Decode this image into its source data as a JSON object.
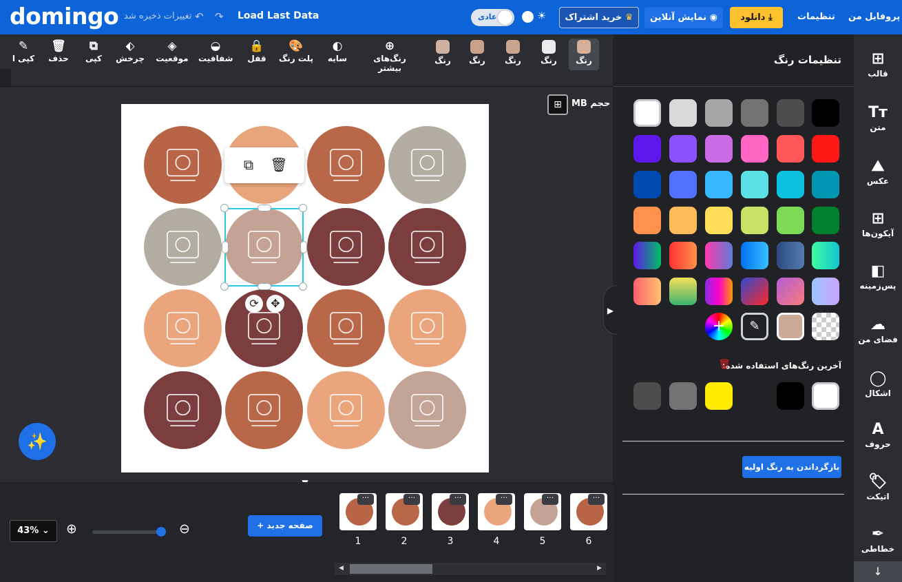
{
  "topbar": {
    "logo": "domingo",
    "save_status": "تغییرات ذخیره شد",
    "undo_icon": "↶",
    "redo_icon": "↷",
    "load_last": "Load Last Data",
    "mode_toggle": "عادی",
    "sun_icon": "☀",
    "subscribe": "خرید اشتراک",
    "crown_icon": "♛",
    "online_preview": "نمایش آنلاین",
    "eye_icon": "◉",
    "download": "دانلود",
    "download_icon": "⤓",
    "settings": "تنظیمات",
    "profile": "پروفایل من"
  },
  "toolbar": {
    "copy_style": "کپی ا",
    "delete": "حذف",
    "copy": "کپی",
    "rotate": "چرخش",
    "position": "موقعیت",
    "opacity": "شفافیت",
    "lock": "قفل",
    "palette": "پلت رنگ",
    "shadow": "سایه",
    "more_colors": "رنگ‌های بیشتر",
    "color_label": "رنگ",
    "color_swatches": [
      "#d4b09a",
      "#ededed",
      "#c9a590",
      "#ececec",
      "#c9a18a",
      "#cdb0a0"
    ]
  },
  "canvas": {
    "size_label": "حجم MB",
    "circle_colors": [
      "#b76546",
      "#e8a47b",
      "#b86848",
      "#b3ada1",
      "#b3ada1",
      "#c5a394",
      "#7b3d3d",
      "#7b3d3d",
      "#eba57c",
      "#7b3d3d",
      "#b86848",
      "#eba57c",
      "#7b3d3d",
      "#b86848",
      "#eba57c",
      "#c2a596"
    ],
    "ctx_copy_icon": "⧉",
    "ctx_delete_icon": "🗑",
    "rotate_icon": "⟳",
    "move_icon": "✥"
  },
  "bottom": {
    "zoom": "43% ⌄",
    "zoom_in_icon": "⊕",
    "zoom_out_icon": "⊖",
    "new_page": "+ صفحه جدید",
    "pages": [
      {
        "num": "1",
        "color": "#b76546"
      },
      {
        "num": "2",
        "color": "#b86848"
      },
      {
        "num": "3",
        "color": "#7b3d3d"
      },
      {
        "num": "4",
        "color": "#eba57c"
      },
      {
        "num": "5",
        "color": "#c5a394"
      },
      {
        "num": "6",
        "color": "#b76546"
      }
    ],
    "more_icon": "···",
    "collapse_icon": "▼"
  },
  "color_panel": {
    "title": "تنظیمات رنگ",
    "recent_label": "آخرین رنگ‌های استفاده شده:",
    "reset_button": "بازگرداندن به رنگ اولیه",
    "solid_rows": [
      [
        "#ffffff",
        "#d9d9d9",
        "#a6a6a6",
        "#737373",
        "#4d4d4d",
        "#000000"
      ],
      [
        "#5e17eb",
        "#8c52ff",
        "#cb6ce6",
        "#ff66c4",
        "#ff5757",
        "#ff1616"
      ],
      [
        "#004aad",
        "#5271ff",
        "#38b6ff",
        "#5ce1e6",
        "#0cc0df",
        "#0097b2"
      ],
      [
        "#ff914d",
        "#ffbd59",
        "#ffde59",
        "#c9e265",
        "#7ed957",
        "#00802b"
      ]
    ],
    "gradient_rows": [
      [
        "linear-gradient(90deg,#5e17eb,#00bf63)",
        "linear-gradient(90deg,#ff3131,#ff914d)",
        "linear-gradient(90deg,#ff3bb0,#5e7bd6)",
        "linear-gradient(90deg,#0070f3,#38c0ff)",
        "linear-gradient(90deg,#2b4c7e,#567ab0)",
        "linear-gradient(90deg,#3ffb9f,#11c6d1)"
      ],
      [
        "linear-gradient(90deg,#ff5f6d,#ffc371)",
        "linear-gradient(180deg,#f5e05a,#3cb371)",
        "linear-gradient(90deg,#8a2be2,#ff00cc,#ff9900)",
        "linear-gradient(135deg,#2d4bd1,#ff2828)",
        "linear-gradient(135deg,#b35cd6,#f97c7c)",
        "linear-gradient(90deg,#a0c4ff,#c7a4ff)"
      ]
    ],
    "special": [
      "transparent",
      "#cbab98",
      "eyedropper",
      "custom"
    ],
    "eyedropper_icon": "✎",
    "plus_icon": "+",
    "recent_colors": [
      "#4d4d4d",
      "#737373",
      "#ffeb00",
      "",
      "#000000",
      "#ffffff"
    ],
    "trash_icon": "🗑"
  },
  "sidebar": [
    {
      "label": "قالب",
      "icon": "⊞"
    },
    {
      "label": "متن",
      "icon": "Tт"
    },
    {
      "label": "عکس",
      "icon": "⛰"
    },
    {
      "label": "آیکون‌ها",
      "icon": "⊞"
    },
    {
      "label": "پس‌زمینه",
      "icon": "◧"
    },
    {
      "label": "فضای من",
      "icon": "☁"
    },
    {
      "label": "اشکال",
      "icon": "◯"
    },
    {
      "label": "حروف",
      "icon": "A"
    },
    {
      "label": "اتیکت",
      "icon": "🏷"
    },
    {
      "label": "خطاطی",
      "icon": "✒"
    }
  ],
  "sidebar_down_icon": "↓"
}
